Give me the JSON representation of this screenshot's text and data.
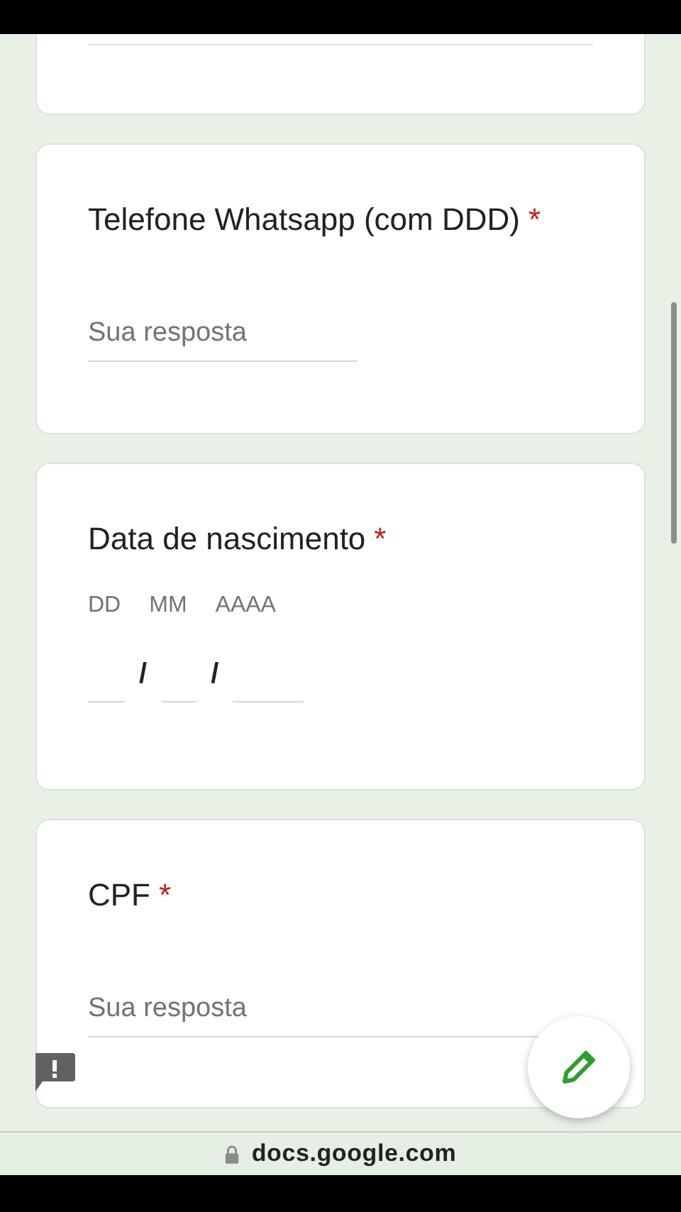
{
  "questions": [
    {
      "kind": "text",
      "title": "Telefone Whatsapp (com DDD)",
      "required_mark": "*",
      "placeholder": "Sua resposta"
    },
    {
      "kind": "date",
      "title": "Data de nascimento",
      "required_mark": "*",
      "parts": [
        {
          "label": "DD"
        },
        {
          "label": "MM"
        },
        {
          "label": "AAAA"
        }
      ],
      "separator": "/"
    },
    {
      "kind": "text",
      "title": "CPF",
      "required_mark": "*",
      "placeholder": "Sua resposta"
    }
  ],
  "address_bar": {
    "url": "docs.google.com"
  }
}
